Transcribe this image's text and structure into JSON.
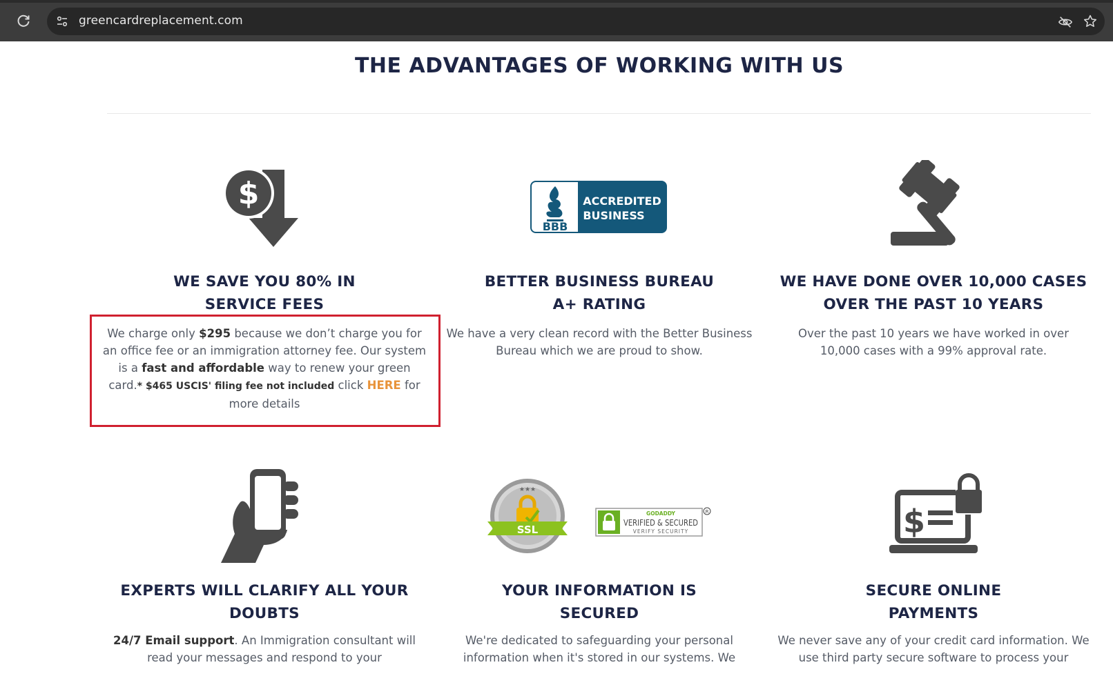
{
  "browser": {
    "url": "greencardreplacement.com"
  },
  "page": {
    "title": "THE ADVANTAGES OF WORKING WITH US"
  },
  "features": [
    {
      "icon": "dollar-down-arrow-icon",
      "heading_line1": "WE SAVE YOU 80% IN",
      "heading_line2": "SERVICE FEES",
      "text_1": "We charge only ",
      "price": "$295",
      "text_2": " because we don’t charge you for an office fee or an immigration attorney fee. Our system is a ",
      "emphasis": "fast and affordable",
      "text_3": " way to renew your green card.",
      "fee_note": "* $465 USCIS' filing fee not included",
      "text_4": " click ",
      "link": "HERE",
      "text_5": " for more details"
    },
    {
      "icon": "bbb-accredited-business-logo",
      "badge_line1": "ACCREDITED",
      "badge_line2": "BUSINESS",
      "badge_bbb": "BBB",
      "heading_line1": "BETTER BUSINESS BUREAU",
      "heading_line2": "A+ RATING",
      "text": "We have a very clean record with the Better Business Bureau which we are proud to show."
    },
    {
      "icon": "gavel-icon",
      "heading_line1": "WE HAVE DONE OVER 10,000 CASES",
      "heading_line2": "OVER THE PAST 10 YEARS",
      "text": "Over the past 10 years we have worked in over 10,000 cases with a 99% approval rate."
    },
    {
      "icon": "hand-phone-icon",
      "heading_line1": "EXPERTS WILL CLARIFY ALL YOUR",
      "heading_line2": "DOUBTS",
      "emphasis": "24/7 Email support",
      "text": ". An Immigration consultant will read your messages and respond to your"
    },
    {
      "icon": "ssl-lock-badge",
      "ssl_label": "SSL",
      "godaddy_top": "GODADDY",
      "godaddy_main": "VERIFIED & SECURED",
      "godaddy_sub": "VERIFY SECURITY",
      "heading_line1": "YOUR INFORMATION IS",
      "heading_line2": "SECURED",
      "text": "We're dedicated to safeguarding your personal information when it's stored in our systems. We"
    },
    {
      "icon": "secure-payment-laptop-icon",
      "heading_line1": "SECURE ONLINE",
      "heading_line2": "PAYMENTS",
      "text": "We never save any of your credit card information. We use third party secure software to process your"
    }
  ],
  "colors": {
    "heading": "#1d2545",
    "body_text": "#555b66",
    "link": "#e8933a",
    "highlight_border": "#d0202f",
    "bbb_blue": "#14587a",
    "icon_gray": "#4a4a4a"
  }
}
